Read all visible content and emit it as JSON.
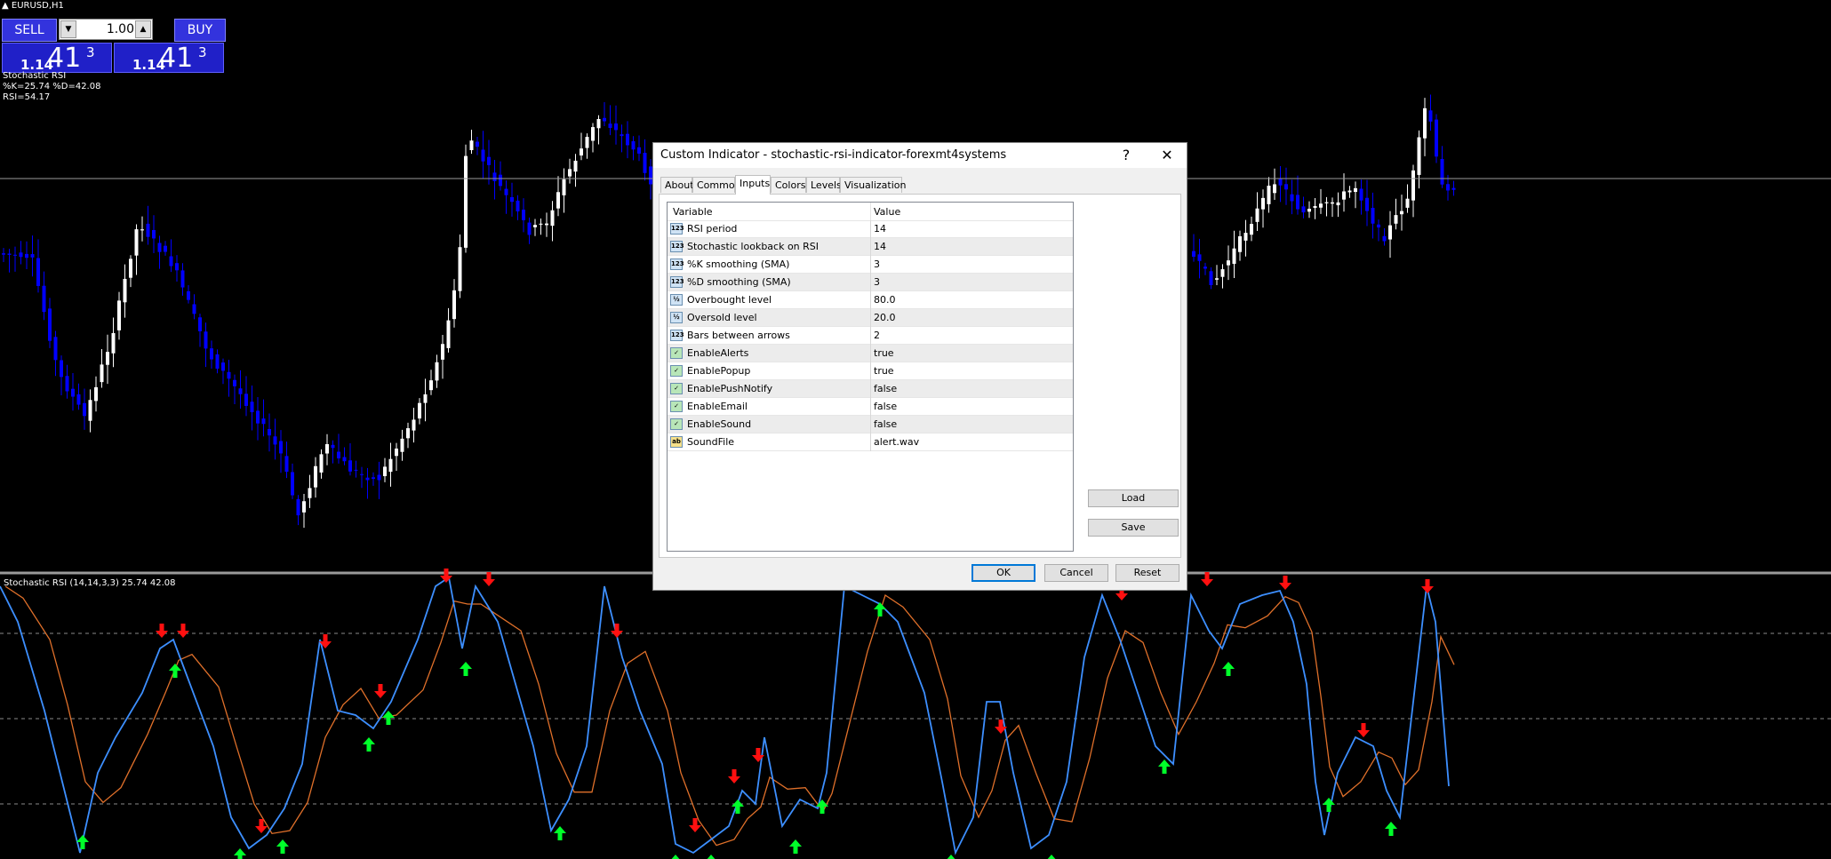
{
  "symbol_label": "EURUSD,H1",
  "trade_panel": {
    "sell_label": "SELL",
    "buy_label": "BUY",
    "lot_value": "1.00",
    "sell_price": {
      "small": "1.14",
      "big": "41",
      "sup": "3"
    },
    "buy_price": {
      "small": "1.14",
      "big": "41",
      "sup": "3"
    }
  },
  "indicator_info": {
    "line1": "Stochastic RSI",
    "line2": "%K=25.74  %D=42.08",
    "line3": "RSI=54.17"
  },
  "subwindow_label": "Stochastic RSI (14,14,3,3) 25.74 42.08",
  "colors": {
    "bull_candle": "#ffffff",
    "bear_candle": "#0000ff",
    "k_line": "#3d8fff",
    "d_line": "#e0702a",
    "up_arrow": "#00ff2a",
    "down_arrow": "#ff1010",
    "level_line": "#8a8a8a"
  },
  "dialog": {
    "title": "Custom Indicator - stochastic-rsi-indicator-forexmt4systems",
    "help_label": "?",
    "close_label": "✕",
    "tabs": [
      "About",
      "Common",
      "Inputs",
      "Colors",
      "Levels",
      "Visualization"
    ],
    "active_tab": "Inputs",
    "headers": {
      "variable": "Variable",
      "value": "Value"
    },
    "params": [
      {
        "icon": "123",
        "name": "RSI period",
        "value": "14"
      },
      {
        "icon": "123",
        "name": "Stochastic lookback on RSI",
        "value": "14"
      },
      {
        "icon": "123",
        "name": "%K smoothing (SMA)",
        "value": "3"
      },
      {
        "icon": "123",
        "name": "%D smoothing (SMA)",
        "value": "3"
      },
      {
        "icon": "½",
        "name": "Overbought level",
        "value": "80.0"
      },
      {
        "icon": "½",
        "name": "Oversold level",
        "value": "20.0"
      },
      {
        "icon": "123",
        "name": "Bars between arrows",
        "value": "2"
      },
      {
        "icon": "bool",
        "name": "EnableAlerts",
        "value": "true"
      },
      {
        "icon": "bool",
        "name": "EnablePopup",
        "value": "true"
      },
      {
        "icon": "bool",
        "name": "EnablePushNotify",
        "value": "false"
      },
      {
        "icon": "bool",
        "name": "EnableEmail",
        "value": "false"
      },
      {
        "icon": "bool",
        "name": "EnableSound",
        "value": "false"
      },
      {
        "icon": "ab",
        "name": "SoundFile",
        "value": "alert.wav"
      }
    ],
    "load_label": "Load",
    "save_label": "Save",
    "ok_label": "OK",
    "cancel_label": "Cancel",
    "reset_label": "Reset"
  }
}
